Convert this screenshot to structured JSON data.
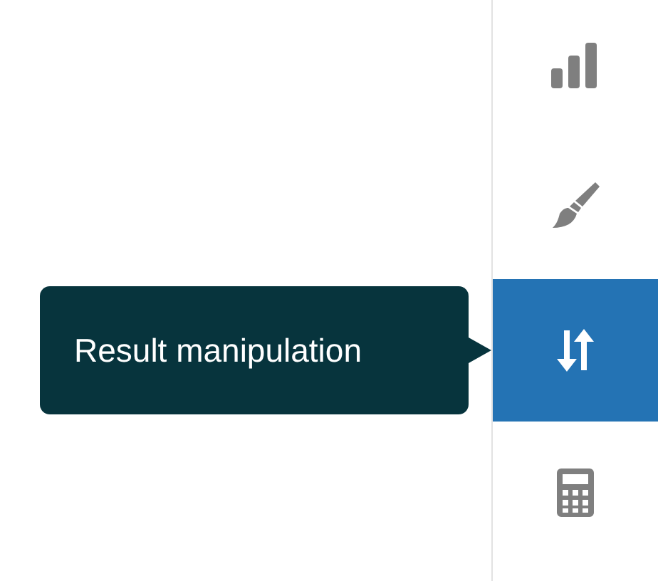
{
  "sidebar": {
    "items": [
      {
        "kind": "chart",
        "selected": false
      },
      {
        "kind": "brush",
        "selected": false
      },
      {
        "kind": "sort",
        "selected": true
      },
      {
        "kind": "calculator",
        "selected": false
      }
    ]
  },
  "tooltip": {
    "text": "Result manipulation"
  }
}
